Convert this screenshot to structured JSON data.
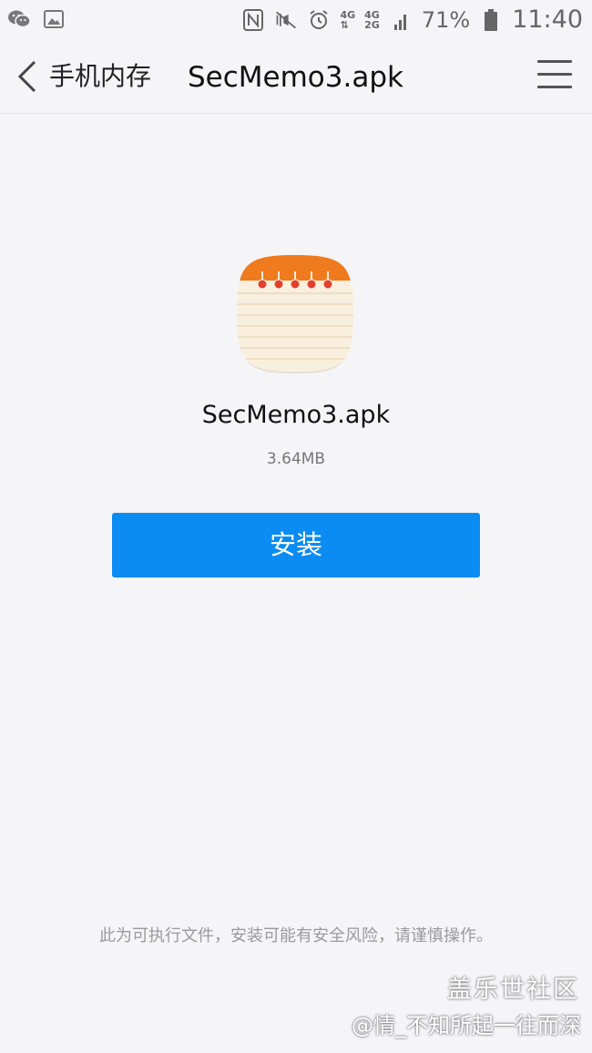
{
  "status_bar": {
    "battery_percent": "71%",
    "time": "11:40",
    "network_1": "4G",
    "network_2": "4G",
    "network_3": "2G",
    "left_icons": [
      "wechat-icon",
      "image-icon"
    ],
    "right_icons": [
      "nfc-icon",
      "mute-icon",
      "alarm-icon",
      "signal-icon",
      "battery-icon"
    ]
  },
  "header": {
    "folder": "手机内存",
    "title": "SecMemo3.apk"
  },
  "app": {
    "name": "SecMemo3.apk",
    "size": "3.64MB",
    "icon": "memo-notebook-icon",
    "icon_colors": {
      "top": "#f07a1e",
      "body": "#f8efdf",
      "rings": "#e0412f"
    }
  },
  "install_button": {
    "label": "安装",
    "color": "#0a8cf2"
  },
  "warning_text": "此为可执行文件，安装可能有安全风险，请谨慎操作。",
  "watermark": {
    "site": "盖乐世社区",
    "user": "@情_不知所起一往而深"
  }
}
